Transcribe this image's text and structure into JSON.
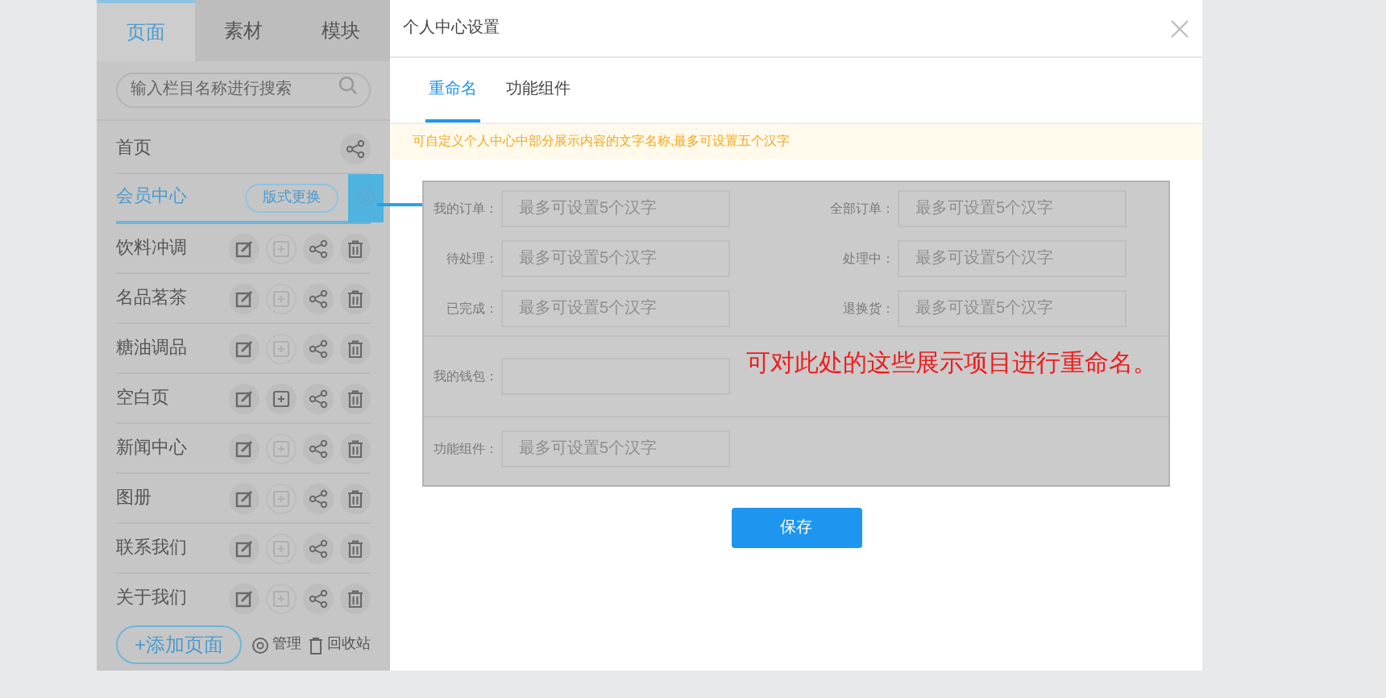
{
  "sidebar": {
    "tabs": [
      {
        "label": "页面",
        "selected": true
      },
      {
        "label": "素材",
        "selected": false
      },
      {
        "label": "模块",
        "selected": false
      }
    ],
    "search": {
      "placeholder": "输入栏目名称进行搜索"
    },
    "pages": [
      {
        "name": "首页",
        "selected": false,
        "actions": [
          {
            "kind": "share",
            "disabled": false
          }
        ]
      },
      {
        "name": "会员中心",
        "selected": true,
        "badge": "版式更换",
        "actions": [
          {
            "kind": "settings",
            "disabled": false
          }
        ]
      },
      {
        "name": "饮料冲调",
        "selected": false,
        "actions": [
          {
            "kind": "edit",
            "disabled": false
          },
          {
            "kind": "copy",
            "disabled": true
          },
          {
            "kind": "share",
            "disabled": false
          },
          {
            "kind": "delete",
            "disabled": false
          }
        ]
      },
      {
        "name": "名品茗茶",
        "selected": false,
        "actions": [
          {
            "kind": "edit",
            "disabled": false
          },
          {
            "kind": "copy",
            "disabled": true
          },
          {
            "kind": "share",
            "disabled": false
          },
          {
            "kind": "delete",
            "disabled": false
          }
        ]
      },
      {
        "name": "糖油调品",
        "selected": false,
        "actions": [
          {
            "kind": "edit",
            "disabled": false
          },
          {
            "kind": "copy",
            "disabled": true
          },
          {
            "kind": "share",
            "disabled": false
          },
          {
            "kind": "delete",
            "disabled": false
          }
        ]
      },
      {
        "name": "空白页",
        "selected": false,
        "actions": [
          {
            "kind": "edit",
            "disabled": false
          },
          {
            "kind": "copy",
            "disabled": false
          },
          {
            "kind": "share",
            "disabled": false
          },
          {
            "kind": "delete",
            "disabled": false
          }
        ]
      },
      {
        "name": "新闻中心",
        "selected": false,
        "actions": [
          {
            "kind": "edit",
            "disabled": false
          },
          {
            "kind": "copy",
            "disabled": true
          },
          {
            "kind": "share",
            "disabled": false
          },
          {
            "kind": "delete",
            "disabled": false
          }
        ]
      },
      {
        "name": "图册",
        "selected": false,
        "actions": [
          {
            "kind": "edit",
            "disabled": false
          },
          {
            "kind": "copy",
            "disabled": true
          },
          {
            "kind": "share",
            "disabled": false
          },
          {
            "kind": "delete",
            "disabled": false
          }
        ]
      },
      {
        "name": "联系我们",
        "selected": false,
        "actions": [
          {
            "kind": "edit",
            "disabled": false
          },
          {
            "kind": "copy",
            "disabled": true
          },
          {
            "kind": "share",
            "disabled": false
          },
          {
            "kind": "delete",
            "disabled": false
          }
        ]
      },
      {
        "name": "关于我们",
        "selected": false,
        "actions": [
          {
            "kind": "edit",
            "disabled": false
          },
          {
            "kind": "copy",
            "disabled": true
          },
          {
            "kind": "share",
            "disabled": false
          },
          {
            "kind": "delete",
            "disabled": false
          }
        ]
      }
    ],
    "add_button": "+添加页面",
    "footer_links": [
      {
        "kind": "manage",
        "label": "管理"
      },
      {
        "kind": "recycle",
        "label": "回收站"
      }
    ]
  },
  "dialog": {
    "title": "个人中心设置",
    "tabs": [
      {
        "label": "重命名",
        "selected": true
      },
      {
        "label": "功能组件",
        "selected": false
      }
    ],
    "notice": "可自定义个人中心中部分展示内容的文字名称,最多可设置五个汉字",
    "sections": [
      {
        "fields": [
          {
            "label": "我的订单：",
            "placeholder": "最多可设置5个汉字"
          },
          {
            "label": "全部订单：",
            "placeholder": "最多可设置5个汉字"
          },
          {
            "label": "待处理：",
            "placeholder": "最多可设置5个汉字"
          },
          {
            "label": "处理中：",
            "placeholder": "最多可设置5个汉字"
          },
          {
            "label": "已完成：",
            "placeholder": "最多可设置5个汉字"
          },
          {
            "label": "退换货：",
            "placeholder": "最多可设置5个汉字"
          }
        ]
      },
      {
        "fields": [
          {
            "label": "我的钱包："
          }
        ]
      },
      {
        "fields": [
          {
            "label": "功能组件：",
            "placeholder": "最多可设置5个汉字"
          }
        ]
      }
    ],
    "annotation": "可对此处的这些展示项目进行重命名。",
    "save_button": "保存"
  }
}
